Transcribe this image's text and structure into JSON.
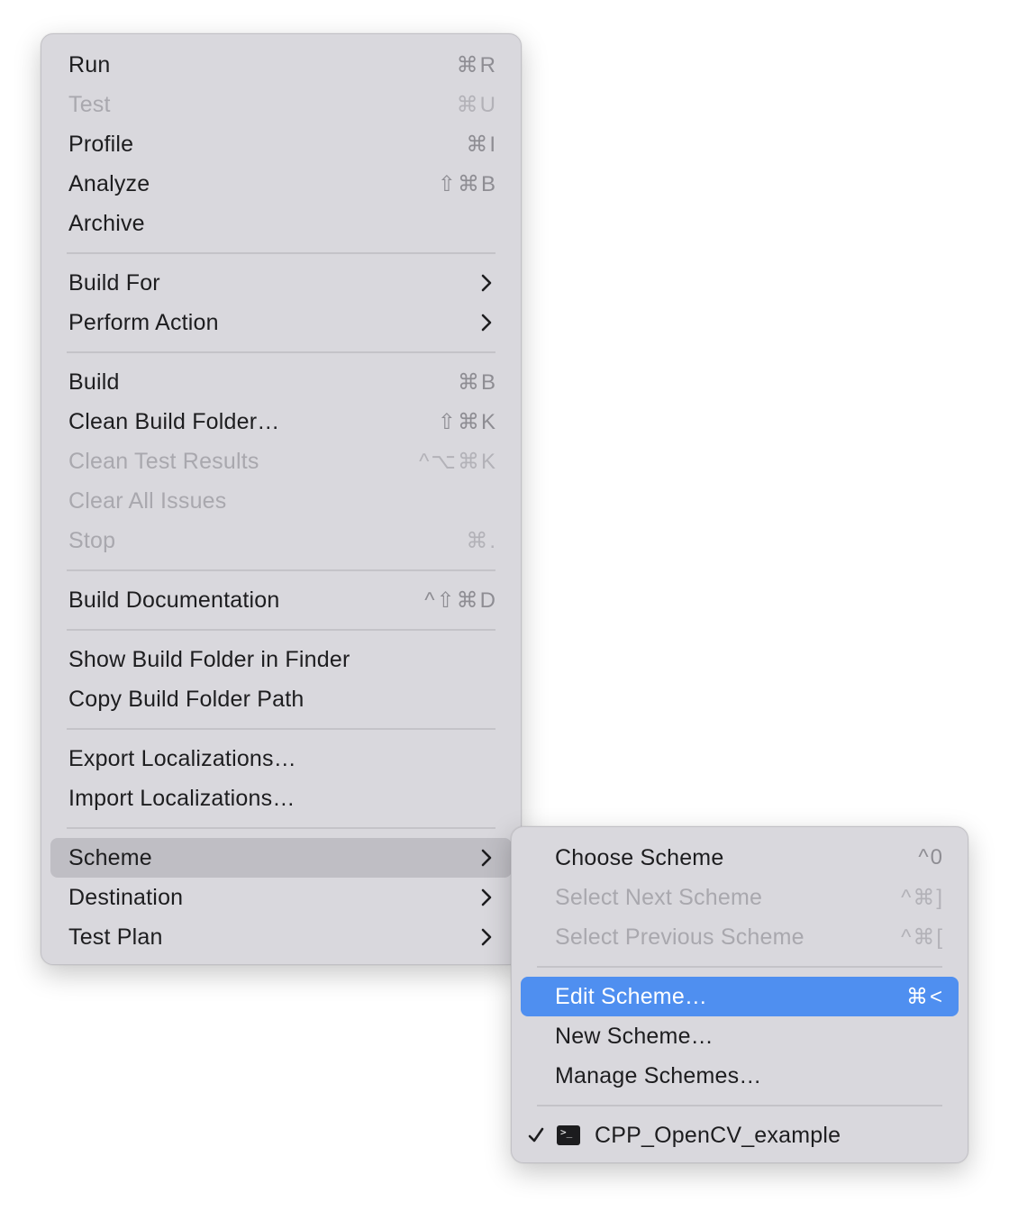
{
  "main_menu": {
    "groups": [
      [
        {
          "label": "Run",
          "shortcut": "⌘R",
          "enabled": true
        },
        {
          "label": "Test",
          "shortcut": "⌘U",
          "enabled": false
        },
        {
          "label": "Profile",
          "shortcut": "⌘I",
          "enabled": true
        },
        {
          "label": "Analyze",
          "shortcut": "⇧⌘B",
          "enabled": true
        },
        {
          "label": "Archive",
          "shortcut": "",
          "enabled": true
        }
      ],
      [
        {
          "label": "Build For",
          "submenu": true,
          "enabled": true
        },
        {
          "label": "Perform Action",
          "submenu": true,
          "enabled": true
        }
      ],
      [
        {
          "label": "Build",
          "shortcut": "⌘B",
          "enabled": true
        },
        {
          "label": "Clean Build Folder…",
          "shortcut": "⇧⌘K",
          "enabled": true
        },
        {
          "label": "Clean Test Results",
          "shortcut": "^⌥⌘K",
          "enabled": false
        },
        {
          "label": "Clear All Issues",
          "shortcut": "",
          "enabled": false
        },
        {
          "label": "Stop",
          "shortcut": "⌘.",
          "enabled": false
        }
      ],
      [
        {
          "label": "Build Documentation",
          "shortcut": "^⇧⌘D",
          "enabled": true
        }
      ],
      [
        {
          "label": "Show Build Folder in Finder",
          "shortcut": "",
          "enabled": true
        },
        {
          "label": "Copy Build Folder Path",
          "shortcut": "",
          "enabled": true
        }
      ],
      [
        {
          "label": "Export Localizations…",
          "shortcut": "",
          "enabled": true
        },
        {
          "label": "Import Localizations…",
          "shortcut": "",
          "enabled": true
        }
      ],
      [
        {
          "label": "Scheme",
          "submenu": true,
          "enabled": true,
          "highlighted": true
        },
        {
          "label": "Destination",
          "submenu": true,
          "enabled": true
        },
        {
          "label": "Test Plan",
          "submenu": true,
          "enabled": true
        }
      ]
    ]
  },
  "scheme_submenu": {
    "groups": [
      [
        {
          "label": "Choose Scheme",
          "shortcut": "^0",
          "enabled": true
        },
        {
          "label": "Select Next Scheme",
          "shortcut": "^⌘]",
          "enabled": false
        },
        {
          "label": "Select Previous Scheme",
          "shortcut": "^⌘[",
          "enabled": false
        }
      ],
      [
        {
          "label": "Edit Scheme…",
          "shortcut": "⌘<",
          "enabled": true,
          "selected": true
        },
        {
          "label": "New Scheme…",
          "shortcut": "",
          "enabled": true
        },
        {
          "label": "Manage Schemes…",
          "shortcut": "",
          "enabled": true
        }
      ]
    ],
    "current_scheme": {
      "label": "CPP_OpenCV_example",
      "checked": true,
      "icon": "terminal-icon",
      "icon_glyph": ">_"
    }
  },
  "colors": {
    "menu_background": "#d9d8dd",
    "selection_blue": "#4f8ff0",
    "hover_gray": "#bfbec4",
    "disabled_text": "#a9a8ae"
  }
}
